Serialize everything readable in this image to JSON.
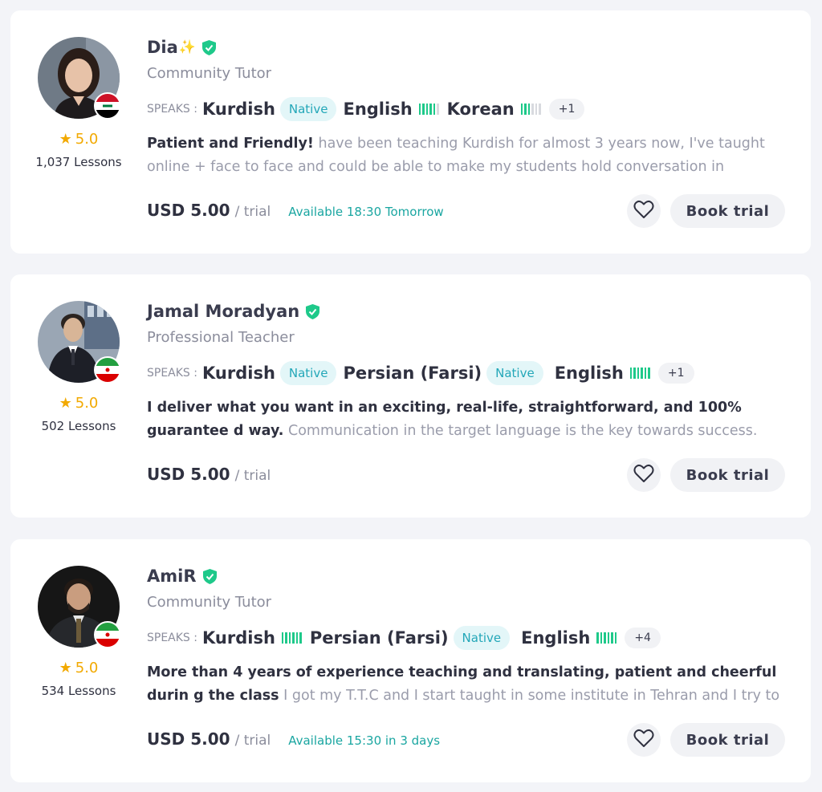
{
  "tutors": [
    {
      "name": "Dia",
      "sparkle": "✨",
      "role": "Community Tutor",
      "rating": "5.0",
      "lessons": "1,037 Lessons",
      "flag": "iraq",
      "languages": [
        {
          "name": "Kurdish",
          "native": true
        },
        {
          "name": "English",
          "level": 5
        },
        {
          "name": "Korean",
          "level": 3
        }
      ],
      "more": "+1",
      "desc_bold": "Patient and Friendly!",
      "desc_text": " have been teaching Kurdish for almost 3 years now, I've taught online + face to face and could be able to make my students hold conversation in Kurdis…",
      "price": "USD 5.00",
      "per": "/ trial",
      "availability": "Available 18:30 Tomorrow"
    },
    {
      "name": "Jamal Moradyan",
      "sparkle": "",
      "role": "Professional Teacher",
      "rating": "5.0",
      "lessons": "502 Lessons",
      "flag": "iran",
      "languages": [
        {
          "name": "Kurdish",
          "native": true
        },
        {
          "name": "Persian (Farsi)",
          "native": true
        },
        {
          "name": "English",
          "level": 6
        }
      ],
      "more": "+1",
      "desc_bold": "I deliver what you want in an exciting, real-life, straightforward, and 100% guarantee d way.",
      "desc_text": " Communication in the target language is the key towards success. The activities,…",
      "price": "USD 5.00",
      "per": "/ trial",
      "availability": ""
    },
    {
      "name": "AmiR",
      "sparkle": "",
      "role": "Community Tutor",
      "rating": "5.0",
      "lessons": "534 Lessons",
      "flag": "iran",
      "languages": [
        {
          "name": "Kurdish",
          "level": 6
        },
        {
          "name": "Persian (Farsi)",
          "native": true
        },
        {
          "name": "English",
          "level": 6
        }
      ],
      "more": "+4",
      "desc_bold": "More than 4 years of experience teaching and translating, patient and cheerful durin g the class",
      "desc_text": " I got my T.T.C and I start taught in some institute in Tehran and I try to have…",
      "price": "USD 5.00",
      "per": "/ trial",
      "availability": "Available 15:30 in 3 days"
    }
  ],
  "labels": {
    "speaks": "SPEAKS :",
    "native": "Native",
    "book_trial": "Book trial"
  },
  "colors": {
    "accent_green": "#1ec98a",
    "native_bg": "#e3f6f8",
    "native_text": "#23a7b8",
    "availability": "#1aa6a1",
    "star": "#f2a900"
  }
}
